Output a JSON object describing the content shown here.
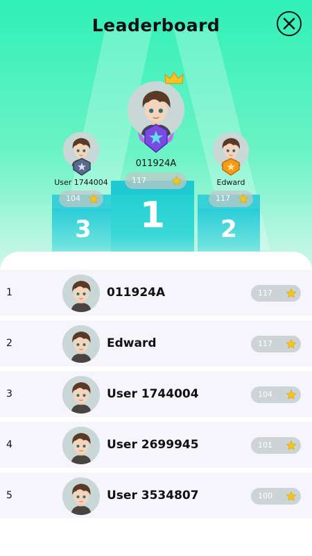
{
  "header": {
    "title": "Leaderboard",
    "close_icon": "close-icon"
  },
  "podium": {
    "first": {
      "name": "011924A",
      "score": "117",
      "rank": "1",
      "badge": "purple-winged-star-badge-icon",
      "crown": "crown-icon"
    },
    "second": {
      "name": "Edward",
      "score": "117",
      "rank": "2",
      "badge": "gold-shield-badge-icon"
    },
    "third": {
      "name": "User 1744004",
      "score": "104",
      "rank": "3",
      "badge": "silver-shield-badge-icon"
    }
  },
  "rows": [
    {
      "rank": "1",
      "name": "011924A",
      "score": "117"
    },
    {
      "rank": "2",
      "name": "Edward",
      "score": "117"
    },
    {
      "rank": "3",
      "name": "User 1744004",
      "score": "104"
    },
    {
      "rank": "4",
      "name": "User 2699945",
      "score": "101"
    },
    {
      "rank": "5",
      "name": "User 3534807",
      "score": "100"
    }
  ],
  "colors": {
    "accent": "#2ff0b6",
    "podium": "#22cfd1",
    "star": "#f5c518"
  }
}
